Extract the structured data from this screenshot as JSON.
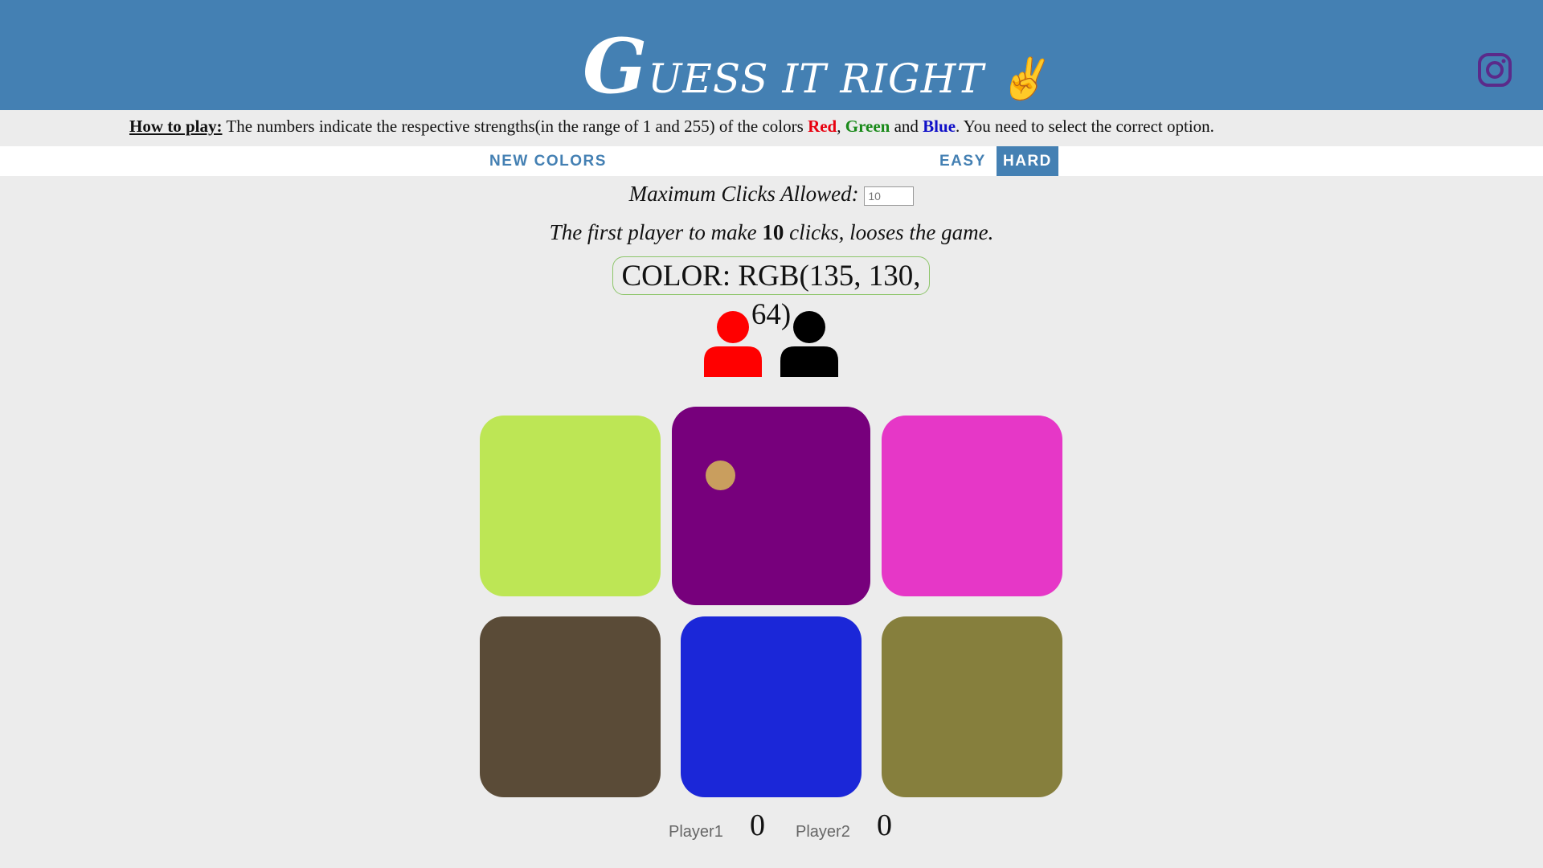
{
  "header": {
    "title_initial": "G",
    "title_rest": "UESS IT RIGHT",
    "peace_symbol": "✌",
    "instagram_icon": "instagram-icon",
    "bg_color": "#4480b3"
  },
  "instructions": {
    "label": "How to play:",
    "text_a": " The numbers indicate the respective strengths(in the range of 1 and 255) of the colors ",
    "red": "Red",
    "sep1": ", ",
    "green": "Green",
    "sep2": " and ",
    "blue": "Blue",
    "text_b": ". You need to select the correct option."
  },
  "nav": {
    "new_colors": "New Colors",
    "easy": "Easy",
    "hard": "Hard",
    "active_mode": "hard"
  },
  "settings": {
    "max_clicks_label": "Maximum Clicks Allowed:",
    "max_clicks_placeholder": "10",
    "rule_before": "The first player to make ",
    "rule_count": "10",
    "rule_after": " clicks, looses the game."
  },
  "target": {
    "label": "COLOR: RGB(135, 130, 64)"
  },
  "players": [
    {
      "name": "Player1",
      "icon": "user-icon",
      "color": "#ff0000",
      "score": "0"
    },
    {
      "name": "Player2",
      "icon": "user-icon",
      "color": "#000000",
      "score": "0"
    }
  ],
  "tiles": [
    {
      "color": "#bde655"
    },
    {
      "color": "#77007c"
    },
    {
      "color": "#e637c7"
    },
    {
      "color": "#5a4b37"
    },
    {
      "color": "#1b27d8"
    },
    {
      "color": "#867f3d"
    }
  ],
  "marker": {
    "color": "#c99e5e"
  }
}
